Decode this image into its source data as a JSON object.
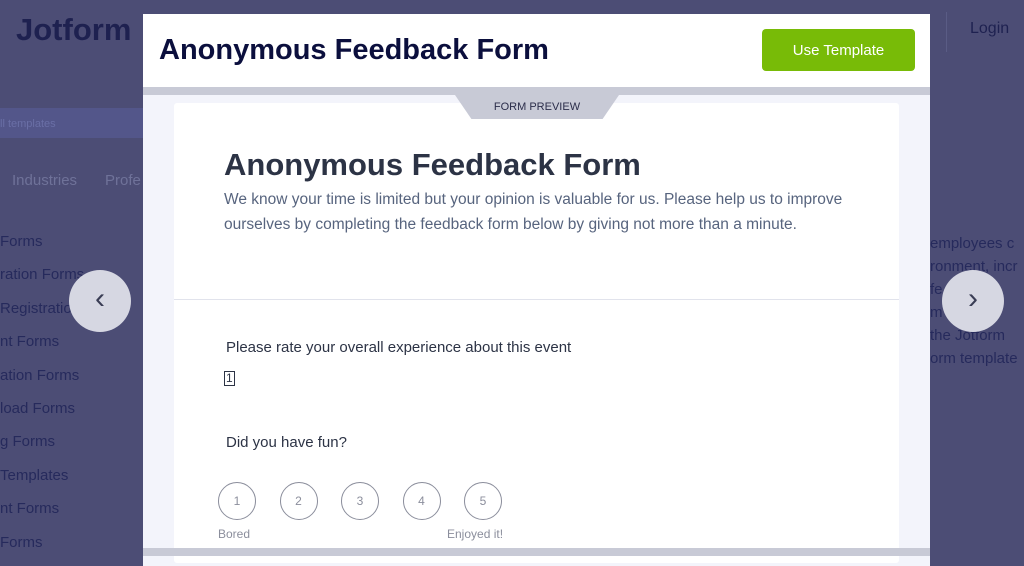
{
  "background": {
    "logo": "Jotform",
    "breadcrumb": "ll templates",
    "tabs": [
      "Industries",
      "Profe"
    ],
    "sidebar": [
      "Forms",
      "ration Forms",
      "Registratio",
      "nt Forms",
      "ation Forms",
      "load Forms",
      "g Forms",
      "Templates",
      "nt Forms",
      "Forms"
    ],
    "login": "Login",
    "right_text": [
      "employees c",
      "ronment, incr",
      "fe          you",
      "m          ou",
      "the Jotform",
      "orm template"
    ]
  },
  "modal": {
    "title": "Anonymous Feedback Form",
    "use_template": "Use Template",
    "preview_tab": "FORM PREVIEW",
    "form": {
      "title": "Anonymous Feedback Form",
      "description": "We know your time is limited but your opinion is valuable for us. Please help us to improve ourselves by completing the feedback form below by giving not more than a minute.",
      "q1": {
        "label": "Please rate your overall experience about this event",
        "value": "1"
      },
      "q2": {
        "label": "Did you have fun?",
        "options": [
          "1",
          "2",
          "3",
          "4",
          "5"
        ],
        "low_label": "Bored",
        "high_label": "Enjoyed it!"
      }
    }
  },
  "nav": {
    "prev_icon": "chevron-left-icon",
    "next_icon": "chevron-right-icon"
  },
  "colors": {
    "accent": "#78bb07",
    "overlay": "#4c4d75"
  }
}
